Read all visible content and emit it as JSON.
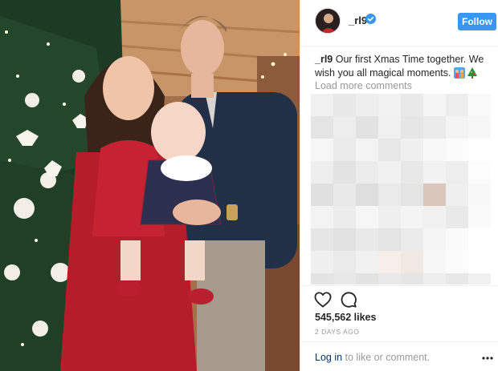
{
  "post": {
    "username": "_rl9",
    "verified": true,
    "follow_label": "Follow",
    "caption_user": "_rl9",
    "caption_text": " Our first Xmas Time together. We wish you all magical moments. ",
    "caption_emojis": [
      "family-emoji",
      "christmas-tree-emoji"
    ],
    "load_more_label": "Load more comments",
    "comments_hidden": true,
    "likes": "545,562 likes",
    "timestamp": "2 DAYS AGO",
    "login_prefix": "Log in",
    "login_suffix": " to like or comment."
  },
  "icons": {
    "like": "heart-icon",
    "comment": "comment-icon",
    "more": "more-options-icon",
    "verified": "verified-badge-icon"
  },
  "colors": {
    "follow_button": "#3897f0",
    "verified_badge": "#3897f0",
    "muted_text": "#999999",
    "login_link": "#003569",
    "divider": "#efefef"
  }
}
